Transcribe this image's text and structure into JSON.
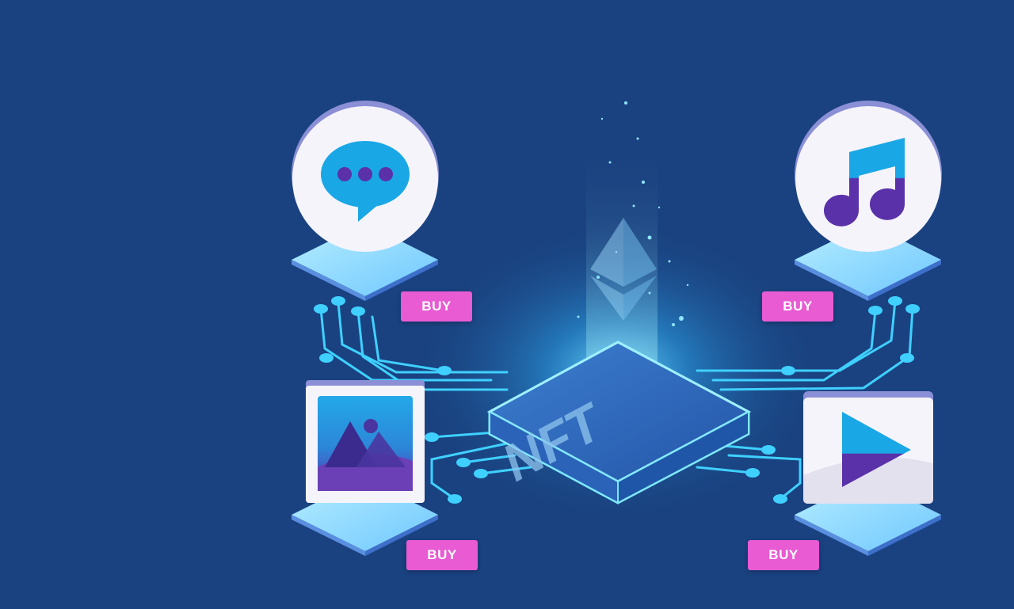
{
  "chip": {
    "label": "NFT"
  },
  "items": [
    {
      "type": "chat",
      "icon": "chat-bubble-icon",
      "buy_label": "BUY"
    },
    {
      "type": "music",
      "icon": "music-note-icon",
      "buy_label": "BUY"
    },
    {
      "type": "image",
      "icon": "image-icon",
      "buy_label": "BUY"
    },
    {
      "type": "video",
      "icon": "play-icon",
      "buy_label": "BUY"
    }
  ],
  "colors": {
    "background": "#1a4280",
    "accent": "#e85bd3",
    "circuit": "#3fd0ff",
    "purple": "#5a31a8",
    "cyan": "#1aa7e6"
  }
}
